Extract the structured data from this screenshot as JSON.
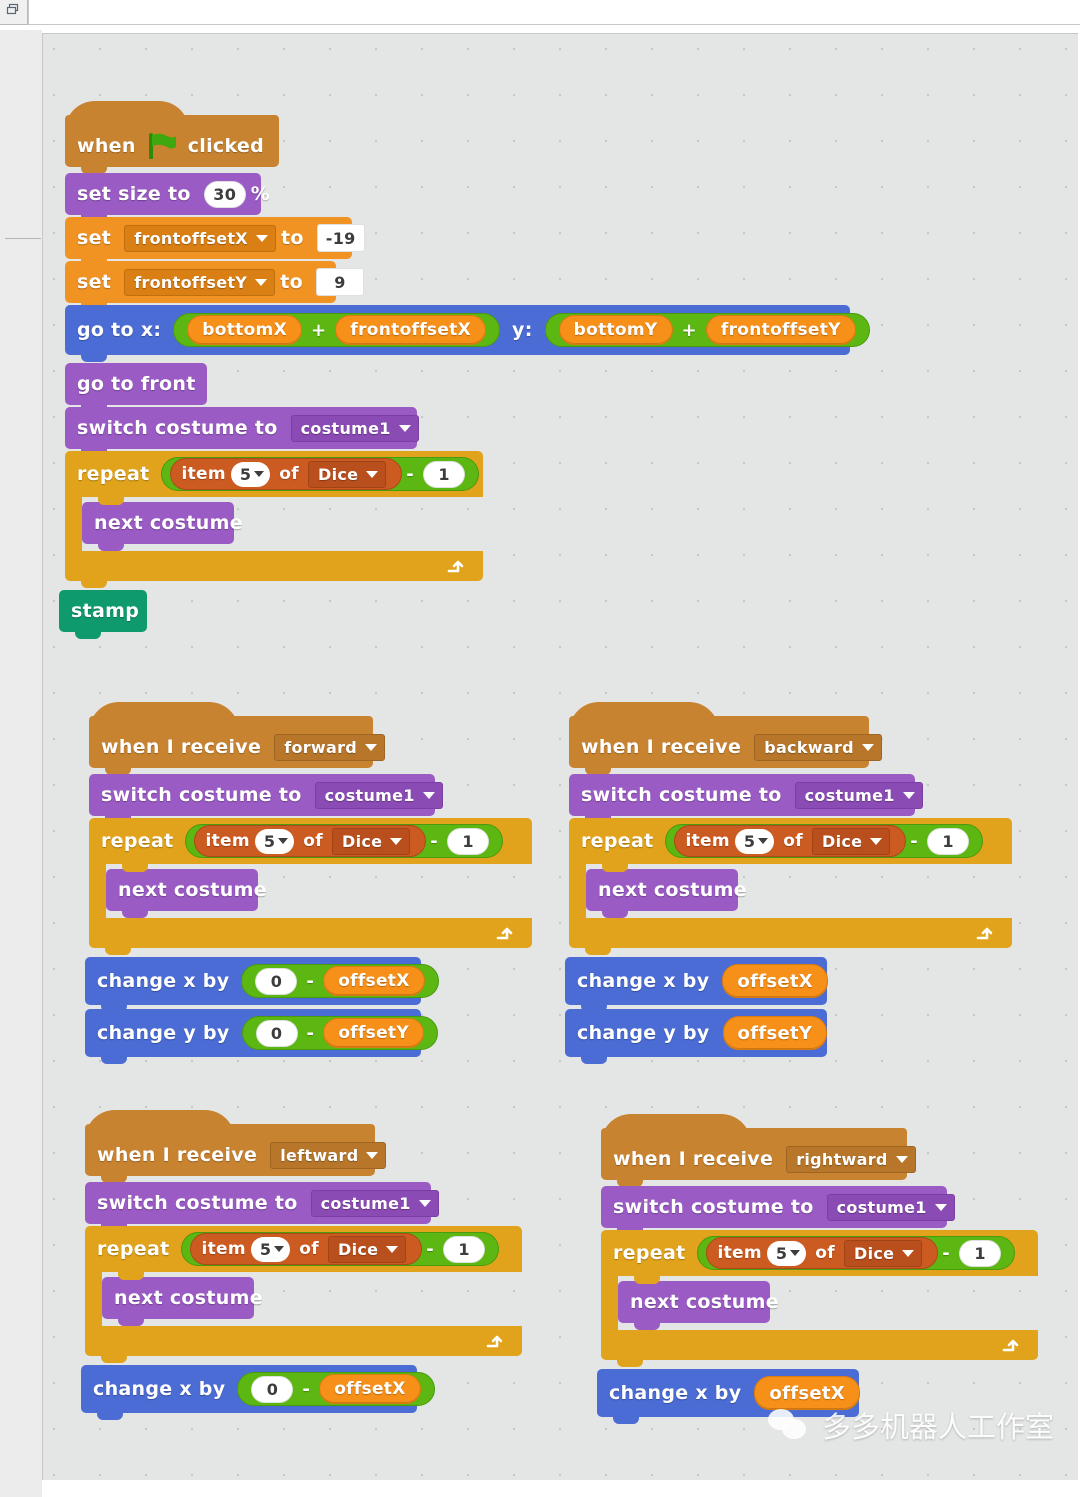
{
  "window": {
    "top_panel_icon": "window-restore-icon"
  },
  "scripts": [
    {
      "id": "green-flag-script",
      "blocks": [
        {
          "kind": "hat",
          "label_a": "when",
          "icon": "green-flag-icon",
          "label_b": "clicked"
        },
        {
          "kind": "set-size",
          "label_a": "set size to",
          "value": "30",
          "label_b": "%"
        },
        {
          "kind": "set-var",
          "label_a": "set",
          "variable": "frontoffsetX",
          "label_b": "to",
          "value": "-19"
        },
        {
          "kind": "set-var",
          "label_a": "set",
          "variable": "frontoffsetY",
          "label_b": "to",
          "value": "9"
        },
        {
          "kind": "go-to-xy",
          "label_a": "go to x:",
          "x_a": "bottomX",
          "x_op": "+",
          "x_b": "frontoffsetX",
          "label_b": "y:",
          "y_a": "bottomY",
          "y_op": "+",
          "y_b": "frontoffsetY"
        },
        {
          "kind": "go-to-front",
          "label_a": "go to front"
        },
        {
          "kind": "switch-costume",
          "label_a": "switch costume to",
          "costume": "costume1"
        },
        {
          "kind": "repeat",
          "label_a": "repeat",
          "item_label": "item",
          "item_index": "5",
          "of_label": "of",
          "list": "Dice",
          "op": "-",
          "operand": "1",
          "inner": "next costume"
        },
        {
          "kind": "stamp",
          "label_a": "stamp"
        }
      ]
    },
    {
      "id": "forward-script",
      "blocks": [
        {
          "kind": "hat-receive",
          "label_a": "when I receive",
          "message": "forward"
        },
        {
          "kind": "switch-costume",
          "label_a": "switch costume to",
          "costume": "costume1"
        },
        {
          "kind": "repeat",
          "label_a": "repeat",
          "item_label": "item",
          "item_index": "5",
          "of_label": "of",
          "list": "Dice",
          "op": "-",
          "operand": "1",
          "inner": "next costume"
        },
        {
          "kind": "change-x-sub",
          "label_a": "change x by",
          "zero": "0",
          "op": "-",
          "variable": "offsetX"
        },
        {
          "kind": "change-y-sub",
          "label_a": "change y by",
          "zero": "0",
          "op": "-",
          "variable": "offsetY"
        }
      ]
    },
    {
      "id": "backward-script",
      "blocks": [
        {
          "kind": "hat-receive",
          "label_a": "when I receive",
          "message": "backward"
        },
        {
          "kind": "switch-costume",
          "label_a": "switch costume to",
          "costume": "costume1"
        },
        {
          "kind": "repeat",
          "label_a": "repeat",
          "item_label": "item",
          "item_index": "5",
          "of_label": "of",
          "list": "Dice",
          "op": "-",
          "operand": "1",
          "inner": "next costume"
        },
        {
          "kind": "change-x",
          "label_a": "change x by",
          "variable": "offsetX"
        },
        {
          "kind": "change-y",
          "label_a": "change y by",
          "variable": "offsetY"
        }
      ]
    },
    {
      "id": "leftward-script",
      "blocks": [
        {
          "kind": "hat-receive",
          "label_a": "when I receive",
          "message": "leftward"
        },
        {
          "kind": "switch-costume",
          "label_a": "switch costume to",
          "costume": "costume1"
        },
        {
          "kind": "repeat",
          "label_a": "repeat",
          "item_label": "item",
          "item_index": "5",
          "of_label": "of",
          "list": "Dice",
          "op": "-",
          "operand": "1",
          "inner": "next costume"
        },
        {
          "kind": "change-x-sub",
          "label_a": "change x by",
          "zero": "0",
          "op": "-",
          "variable": "offsetX"
        }
      ]
    },
    {
      "id": "rightward-script",
      "blocks": [
        {
          "kind": "hat-receive",
          "label_a": "when I receive",
          "message": "rightward"
        },
        {
          "kind": "switch-costume",
          "label_a": "switch costume to",
          "costume": "costume1"
        },
        {
          "kind": "repeat",
          "label_a": "repeat",
          "item_label": "item",
          "item_index": "5",
          "of_label": "of",
          "list": "Dice",
          "op": "-",
          "operand": "1",
          "inner": "next costume"
        },
        {
          "kind": "change-x",
          "label_a": "change x by",
          "variable": "offsetX"
        }
      ]
    }
  ],
  "s1": {
    "when": "when",
    "clicked": "clicked",
    "set_size_to": "set size to",
    "size_value": "30",
    "percent": "%",
    "set": "set",
    "var_front_x": "frontoffsetX",
    "to": "to",
    "front_x_value": "-19",
    "var_front_y": "frontoffsetY",
    "front_y_value": "9",
    "go_to_x": "go to x:",
    "bottom_x": "bottomX",
    "plus": "+",
    "front_offset_x": "frontoffsetX",
    "y_label": "y:",
    "bottom_y": "bottomY",
    "front_offset_y": "frontoffsetY",
    "go_to_front": "go to front",
    "switch_costume_to": "switch costume to",
    "costume": "costume1",
    "repeat": "repeat",
    "item": "item",
    "item_index": "5",
    "of": "of",
    "list": "Dice",
    "minus": "-",
    "one": "1",
    "next_costume": "next costume",
    "stamp": "stamp"
  },
  "s2": {
    "when_i_receive": "when I receive",
    "message": "forward",
    "switch_costume_to": "switch costume to",
    "costume": "costume1",
    "repeat": "repeat",
    "item": "item",
    "item_index": "5",
    "of": "of",
    "list": "Dice",
    "minus": "-",
    "one": "1",
    "next_costume": "next costume",
    "change_x_by": "change x by",
    "zero_x": "0",
    "minus_x": "-",
    "offset_x": "offsetX",
    "change_y_by": "change y by",
    "zero_y": "0",
    "minus_y": "-",
    "offset_y": "offsetY"
  },
  "s3": {
    "when_i_receive": "when I receive",
    "message": "backward",
    "switch_costume_to": "switch costume to",
    "costume": "costume1",
    "repeat": "repeat",
    "item": "item",
    "item_index": "5",
    "of": "of",
    "list": "Dice",
    "minus": "-",
    "one": "1",
    "next_costume": "next costume",
    "change_x_by": "change x by",
    "offset_x": "offsetX",
    "change_y_by": "change y by",
    "offset_y": "offsetY"
  },
  "s4": {
    "when_i_receive": "when I receive",
    "message": "leftward",
    "switch_costume_to": "switch costume to",
    "costume": "costume1",
    "repeat": "repeat",
    "item": "item",
    "item_index": "5",
    "of": "of",
    "list": "Dice",
    "minus": "-",
    "one": "1",
    "next_costume": "next costume",
    "change_x_by": "change x by",
    "zero_x": "0",
    "minus_x": "-",
    "offset_x": "offsetX"
  },
  "s5": {
    "when_i_receive": "when I receive",
    "message": "rightward",
    "switch_costume_to": "switch costume to",
    "costume": "costume1",
    "repeat": "repeat",
    "item": "item",
    "item_index": "5",
    "of": "of",
    "list": "Dice",
    "minus": "-",
    "one": "1",
    "next_costume": "next costume",
    "change_x_by": "change x by",
    "offset_x": "offsetX"
  },
  "watermark": {
    "text": "多多机器人工作室",
    "icon": "wechat-icon"
  },
  "colors": {
    "events": "#c88330",
    "looks": "#9a5bc4",
    "data": "#f09322",
    "motion": "#4a6cd4",
    "control": "#e0a31b",
    "pen": "#0e9a6c",
    "operators": "#5cb712",
    "list": "#cc5b22",
    "canvas": "#e4e6e5"
  }
}
